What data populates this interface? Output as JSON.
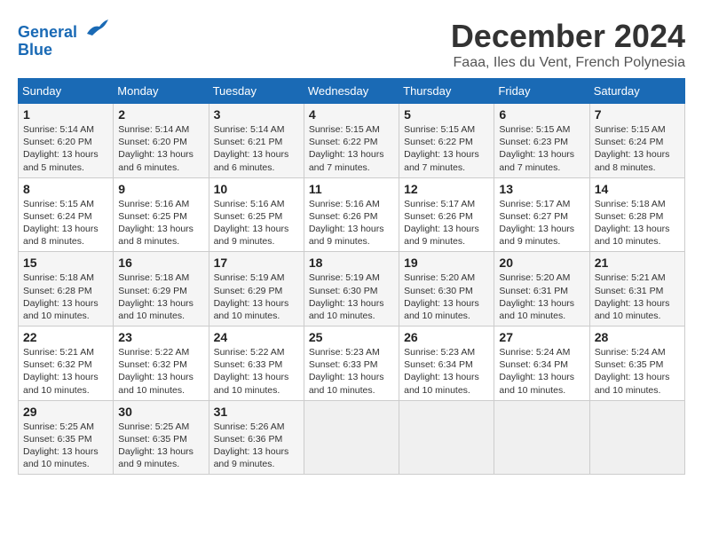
{
  "logo": {
    "line1": "General",
    "line2": "Blue"
  },
  "title": "December 2024",
  "subtitle": "Faaa, Iles du Vent, French Polynesia",
  "weekdays": [
    "Sunday",
    "Monday",
    "Tuesday",
    "Wednesday",
    "Thursday",
    "Friday",
    "Saturday"
  ],
  "weeks": [
    [
      {
        "day": "1",
        "info": "Sunrise: 5:14 AM\nSunset: 6:20 PM\nDaylight: 13 hours\nand 5 minutes."
      },
      {
        "day": "2",
        "info": "Sunrise: 5:14 AM\nSunset: 6:20 PM\nDaylight: 13 hours\nand 6 minutes."
      },
      {
        "day": "3",
        "info": "Sunrise: 5:14 AM\nSunset: 6:21 PM\nDaylight: 13 hours\nand 6 minutes."
      },
      {
        "day": "4",
        "info": "Sunrise: 5:15 AM\nSunset: 6:22 PM\nDaylight: 13 hours\nand 7 minutes."
      },
      {
        "day": "5",
        "info": "Sunrise: 5:15 AM\nSunset: 6:22 PM\nDaylight: 13 hours\nand 7 minutes."
      },
      {
        "day": "6",
        "info": "Sunrise: 5:15 AM\nSunset: 6:23 PM\nDaylight: 13 hours\nand 7 minutes."
      },
      {
        "day": "7",
        "info": "Sunrise: 5:15 AM\nSunset: 6:24 PM\nDaylight: 13 hours\nand 8 minutes."
      }
    ],
    [
      {
        "day": "8",
        "info": "Sunrise: 5:15 AM\nSunset: 6:24 PM\nDaylight: 13 hours\nand 8 minutes."
      },
      {
        "day": "9",
        "info": "Sunrise: 5:16 AM\nSunset: 6:25 PM\nDaylight: 13 hours\nand 8 minutes."
      },
      {
        "day": "10",
        "info": "Sunrise: 5:16 AM\nSunset: 6:25 PM\nDaylight: 13 hours\nand 9 minutes."
      },
      {
        "day": "11",
        "info": "Sunrise: 5:16 AM\nSunset: 6:26 PM\nDaylight: 13 hours\nand 9 minutes."
      },
      {
        "day": "12",
        "info": "Sunrise: 5:17 AM\nSunset: 6:26 PM\nDaylight: 13 hours\nand 9 minutes."
      },
      {
        "day": "13",
        "info": "Sunrise: 5:17 AM\nSunset: 6:27 PM\nDaylight: 13 hours\nand 9 minutes."
      },
      {
        "day": "14",
        "info": "Sunrise: 5:18 AM\nSunset: 6:28 PM\nDaylight: 13 hours\nand 10 minutes."
      }
    ],
    [
      {
        "day": "15",
        "info": "Sunrise: 5:18 AM\nSunset: 6:28 PM\nDaylight: 13 hours\nand 10 minutes."
      },
      {
        "day": "16",
        "info": "Sunrise: 5:18 AM\nSunset: 6:29 PM\nDaylight: 13 hours\nand 10 minutes."
      },
      {
        "day": "17",
        "info": "Sunrise: 5:19 AM\nSunset: 6:29 PM\nDaylight: 13 hours\nand 10 minutes."
      },
      {
        "day": "18",
        "info": "Sunrise: 5:19 AM\nSunset: 6:30 PM\nDaylight: 13 hours\nand 10 minutes."
      },
      {
        "day": "19",
        "info": "Sunrise: 5:20 AM\nSunset: 6:30 PM\nDaylight: 13 hours\nand 10 minutes."
      },
      {
        "day": "20",
        "info": "Sunrise: 5:20 AM\nSunset: 6:31 PM\nDaylight: 13 hours\nand 10 minutes."
      },
      {
        "day": "21",
        "info": "Sunrise: 5:21 AM\nSunset: 6:31 PM\nDaylight: 13 hours\nand 10 minutes."
      }
    ],
    [
      {
        "day": "22",
        "info": "Sunrise: 5:21 AM\nSunset: 6:32 PM\nDaylight: 13 hours\nand 10 minutes."
      },
      {
        "day": "23",
        "info": "Sunrise: 5:22 AM\nSunset: 6:32 PM\nDaylight: 13 hours\nand 10 minutes."
      },
      {
        "day": "24",
        "info": "Sunrise: 5:22 AM\nSunset: 6:33 PM\nDaylight: 13 hours\nand 10 minutes."
      },
      {
        "day": "25",
        "info": "Sunrise: 5:23 AM\nSunset: 6:33 PM\nDaylight: 13 hours\nand 10 minutes."
      },
      {
        "day": "26",
        "info": "Sunrise: 5:23 AM\nSunset: 6:34 PM\nDaylight: 13 hours\nand 10 minutes."
      },
      {
        "day": "27",
        "info": "Sunrise: 5:24 AM\nSunset: 6:34 PM\nDaylight: 13 hours\nand 10 minutes."
      },
      {
        "day": "28",
        "info": "Sunrise: 5:24 AM\nSunset: 6:35 PM\nDaylight: 13 hours\nand 10 minutes."
      }
    ],
    [
      {
        "day": "29",
        "info": "Sunrise: 5:25 AM\nSunset: 6:35 PM\nDaylight: 13 hours\nand 10 minutes."
      },
      {
        "day": "30",
        "info": "Sunrise: 5:25 AM\nSunset: 6:35 PM\nDaylight: 13 hours\nand 9 minutes."
      },
      {
        "day": "31",
        "info": "Sunrise: 5:26 AM\nSunset: 6:36 PM\nDaylight: 13 hours\nand 9 minutes."
      },
      {
        "day": "",
        "info": ""
      },
      {
        "day": "",
        "info": ""
      },
      {
        "day": "",
        "info": ""
      },
      {
        "day": "",
        "info": ""
      }
    ]
  ]
}
